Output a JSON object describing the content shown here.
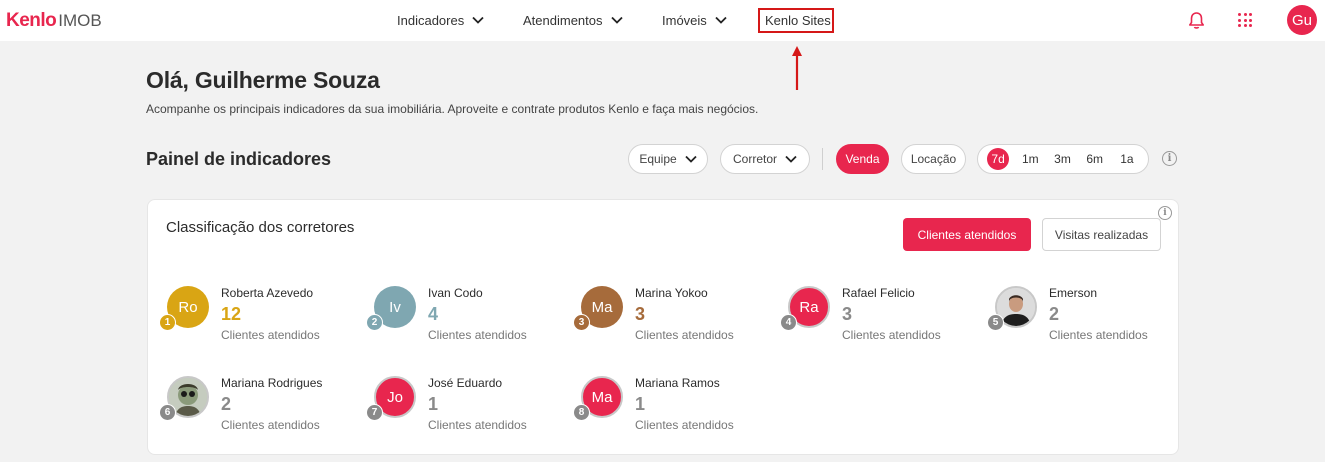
{
  "header": {
    "logo_brand": "Kenlo",
    "logo_product": "IMOB",
    "nav": [
      {
        "label": "Indicadores"
      },
      {
        "label": "Atendimentos"
      },
      {
        "label": "Imóveis"
      },
      {
        "label": "Kenlo Sites"
      }
    ],
    "user_initials": "Gu",
    "icons": [
      "bell-icon",
      "apps-grid-icon"
    ]
  },
  "greeting": "Olá, Guilherme Souza",
  "subtitle": "Acompanhe os principais indicadores da sua imobiliária. Aproveite e contrate produtos Kenlo e faça mais negócios.",
  "panel": {
    "title": "Painel de indicadores",
    "filters": {
      "team": "Equipe",
      "broker": "Corretor"
    },
    "business_type": {
      "sale": "Venda",
      "rent": "Locação",
      "selected": "Venda"
    },
    "periods": [
      "7d",
      "1m",
      "3m",
      "6m",
      "1a"
    ],
    "selected_period": "7d"
  },
  "ranking": {
    "title": "Classificação dos corretores",
    "tab_clients": "Clientes atendidos",
    "tab_visits": "Visitas realizadas",
    "selected_tab": "Clientes atendidos",
    "brokers": [
      {
        "rank": "1",
        "initials": "Ro",
        "name": "Roberta Azevedo",
        "count": "12",
        "label": "Clientes atendidos",
        "avatar_color": "#d9a514",
        "rank_color": "#d9a514",
        "count_color": "#d9a514"
      },
      {
        "rank": "2",
        "initials": "Iv",
        "name": "Ivan Codo",
        "count": "4",
        "label": "Clientes atendidos",
        "avatar_color": "#7fa7b1",
        "rank_color": "#7fa7b1",
        "count_color": "#7fa7b1"
      },
      {
        "rank": "3",
        "initials": "Ma",
        "name": "Marina Yokoo",
        "count": "3",
        "label": "Clientes atendidos",
        "avatar_color": "#a66b3b",
        "rank_color": "#a66b3b",
        "count_color": "#a66b3b"
      },
      {
        "rank": "4",
        "initials": "Ra",
        "name": "Rafael Felicio",
        "count": "3",
        "label": "Clientes atendidos",
        "avatar_color": "#e8264e",
        "rank_color": "#8a8a8a",
        "count_color": "#8a8a8a"
      },
      {
        "rank": "5",
        "initials": "",
        "name": "Emerson",
        "count": "2",
        "label": "Clientes atendidos",
        "avatar_color": "photo",
        "rank_color": "#8a8a8a",
        "count_color": "#8a8a8a"
      },
      {
        "rank": "6",
        "initials": "",
        "name": "Mariana Rodrigues",
        "count": "2",
        "label": "Clientes atendidos",
        "avatar_color": "photo",
        "rank_color": "#8a8a8a",
        "count_color": "#8a8a8a"
      },
      {
        "rank": "7",
        "initials": "Jo",
        "name": "José Eduardo",
        "count": "1",
        "label": "Clientes atendidos",
        "avatar_color": "#e8264e",
        "rank_color": "#8a8a8a",
        "count_color": "#8a8a8a"
      },
      {
        "rank": "8",
        "initials": "Ma",
        "name": "Mariana Ramos",
        "count": "1",
        "label": "Clientes atendidos",
        "avatar_color": "#e8264e",
        "rank_color": "#8a8a8a",
        "count_color": "#8a8a8a"
      }
    ]
  },
  "colors": {
    "accent": "#e8264e",
    "highlight_box": "#d51818"
  }
}
